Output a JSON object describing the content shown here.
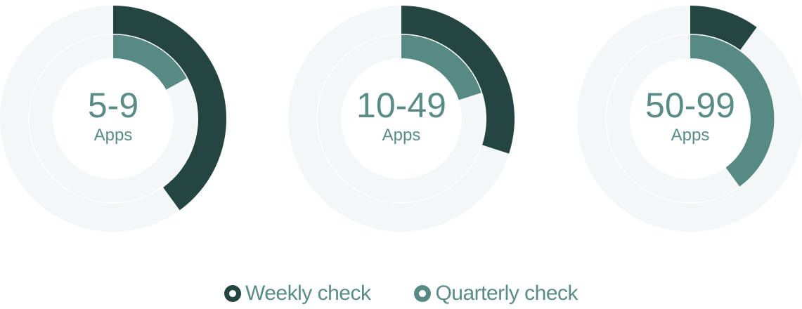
{
  "chart_data": {
    "type": "radial-bar",
    "value_unit": "fraction of full circle",
    "colors": {
      "weekly": "#244542",
      "quarterly": "#588a85",
      "track": "#f3f7f7",
      "text": "#5a8c87"
    },
    "legend_placement": "bottom-center",
    "series": [
      {
        "name": "Weekly check",
        "ring": "outer"
      },
      {
        "name": "Quarterly check",
        "ring": "inner"
      }
    ],
    "charts": [
      {
        "label": "5-9",
        "sublabel": "Apps",
        "weekly": 0.4,
        "quarterly": 0.17
      },
      {
        "label": "10-49",
        "sublabel": "Apps",
        "weekly": 0.3,
        "quarterly": 0.2
      },
      {
        "label": "50-99",
        "sublabel": "Apps",
        "weekly": 0.1,
        "quarterly": 0.4
      }
    ]
  },
  "legend": {
    "items": [
      {
        "label": "Weekly check",
        "color": "#244542"
      },
      {
        "label": "Quarterly check",
        "color": "#588a85"
      }
    ]
  }
}
